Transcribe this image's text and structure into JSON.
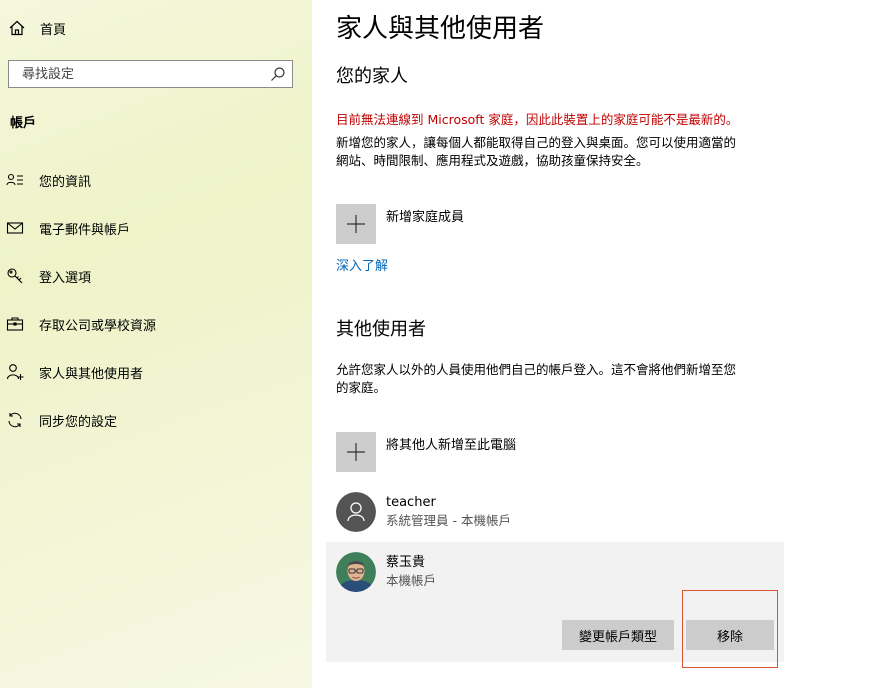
{
  "sidebar": {
    "home_label": "首頁",
    "search_placeholder": "尋找設定",
    "section_label": "帳戶",
    "items": [
      {
        "label": "您的資訊",
        "icon": "contact-info-icon"
      },
      {
        "label": "電子郵件與帳戶",
        "icon": "mail-icon"
      },
      {
        "label": "登入選項",
        "icon": "key-icon"
      },
      {
        "label": "存取公司或學校資源",
        "icon": "briefcase-icon"
      },
      {
        "label": "家人與其他使用者",
        "icon": "add-person-icon",
        "selected": true
      },
      {
        "label": "同步您的設定",
        "icon": "sync-icon"
      }
    ]
  },
  "main": {
    "title": "家人與其他使用者",
    "family": {
      "heading": "您的家人",
      "warning": "目前無法連線到 Microsoft 家庭，因此此裝置上的家庭可能不是最新的。",
      "description_line1": "新增您的家人，讓每個人都能取得自己的登入與桌面。您可以使用適當的",
      "description_line2": "網站、時間限制、應用程式及遊戲，協助孩童保持安全。",
      "add_label": "新增家庭成員",
      "learn_more": "深入了解"
    },
    "others": {
      "heading": "其他使用者",
      "description_line1": "允許您家人以外的人員使用他們自己的帳戶登入。這不會將他們新增至您",
      "description_line2": "的家庭。",
      "add_label": "將其他人新增至此電腦",
      "users": [
        {
          "name": "teacher",
          "subtitle": "系統管理員 - 本機帳戶"
        },
        {
          "name": "蔡玉貴",
          "subtitle": "本機帳戶"
        }
      ],
      "change_type_button": "變更帳戶類型",
      "remove_button": "移除"
    }
  },
  "colors": {
    "warning": "#c00000",
    "link": "#0067b8",
    "highlight_box": "#d9532f",
    "button_bg": "#cccccc"
  }
}
